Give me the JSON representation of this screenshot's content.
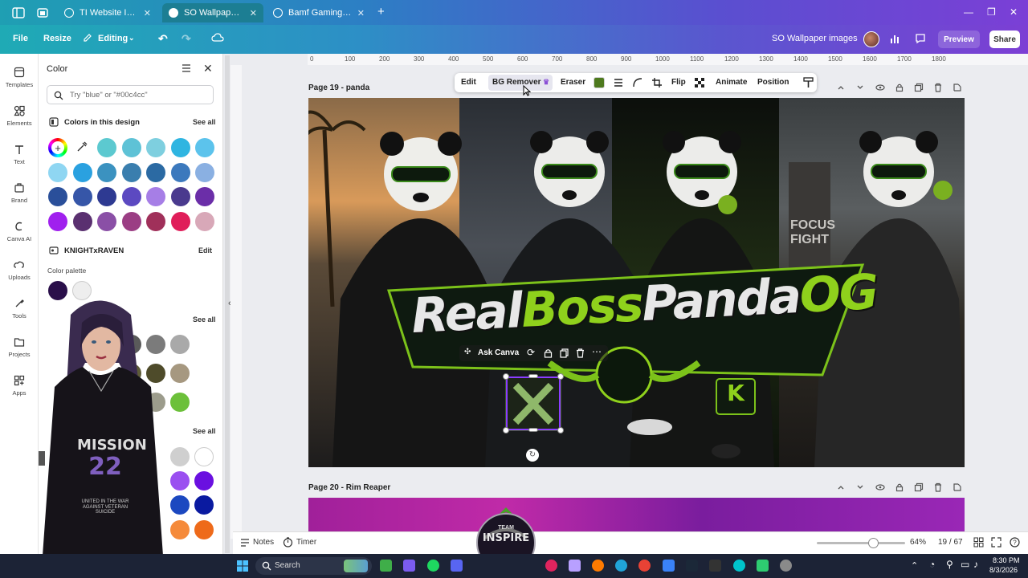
{
  "browser": {
    "tabs": [
      {
        "title": "TI Website Icons - ...",
        "active": false
      },
      {
        "title": "SO Wallpaper imag...",
        "active": true
      },
      {
        "title": "Bamf Gaming stuff ...",
        "active": false
      }
    ]
  },
  "toolbar": {
    "file": "File",
    "resize": "Resize",
    "editing": "Editing",
    "doc_title": "SO Wallpaper images",
    "preview": "Preview",
    "share": "Share"
  },
  "rail": {
    "items": [
      "Templates",
      "Elements",
      "Text",
      "Brand",
      "Canva AI",
      "Uploads",
      "Tools",
      "Projects",
      "Apps"
    ]
  },
  "color_panel": {
    "title": "Color",
    "search_placeholder": "Try \"blue\" or \"#00c4cc\"",
    "colors_in_design": "Colors in this design",
    "see_all": "See all",
    "brand_kit": "KNIGHTxRAVEN",
    "edit": "Edit",
    "color_palette": "Color palette",
    "design_colors": [
      "#5cc9d0",
      "#5ec2d6",
      "#7ecfdf",
      "#2fb5e1",
      "#5cc3ec",
      "#8fd6f2",
      "#2aa1e0",
      "#3b92c0",
      "#3a7eae",
      "#2b6aa3",
      "#3c79bd",
      "#8ab0e2",
      "#2a4f9a",
      "#3656a8",
      "#2e3a92",
      "#5c49c1",
      "#a67ee6",
      "#4a3a8e",
      "#6b2ea8",
      "#a020ee",
      "#5a3070",
      "#8a4fa6",
      "#9b3e84",
      "#a0305a",
      "#e01e5a",
      "#d8a8b8"
    ],
    "palette": [
      "#2a0f4a",
      "#e8e8e8"
    ]
  },
  "canvas": {
    "ruler_labels": [
      "0",
      "100",
      "200",
      "300",
      "400",
      "500",
      "600",
      "700",
      "800",
      "900",
      "1000",
      "1100",
      "1200",
      "1300",
      "1400",
      "1500",
      "1600",
      "1700",
      "1800"
    ],
    "page19_label": "Page 19 - panda",
    "page20_label": "Page 20 - Rim Reaper",
    "context_toolbar": {
      "edit": "Edit",
      "bg_remover": "BG Remover",
      "eraser": "Eraser",
      "flip": "Flip",
      "animate": "Animate",
      "position": "Position"
    },
    "ask_canva": "Ask Canva",
    "banner_text": {
      "part1": "Real",
      "part2": "Boss",
      "part3": "Panda",
      "part4": "OG"
    },
    "sign_text": "FOCUS FIGHT"
  },
  "overlay": {
    "shirt_title": "MISSION",
    "shirt_number": "22",
    "shirt_sub": "UNITED IN THE WAR AGAINST VETERAN SUICIDE",
    "badge_top": "TEAM",
    "badge_main": "INSPIRE"
  },
  "bottom_bar": {
    "notes": "Notes",
    "timer": "Timer",
    "zoom": "64%",
    "page_count": "19 / 67",
    "zoom_fraction": 0.64
  },
  "taskbar": {
    "search": "Search",
    "time": "8:30 PM",
    "date": "8/3/2026"
  }
}
